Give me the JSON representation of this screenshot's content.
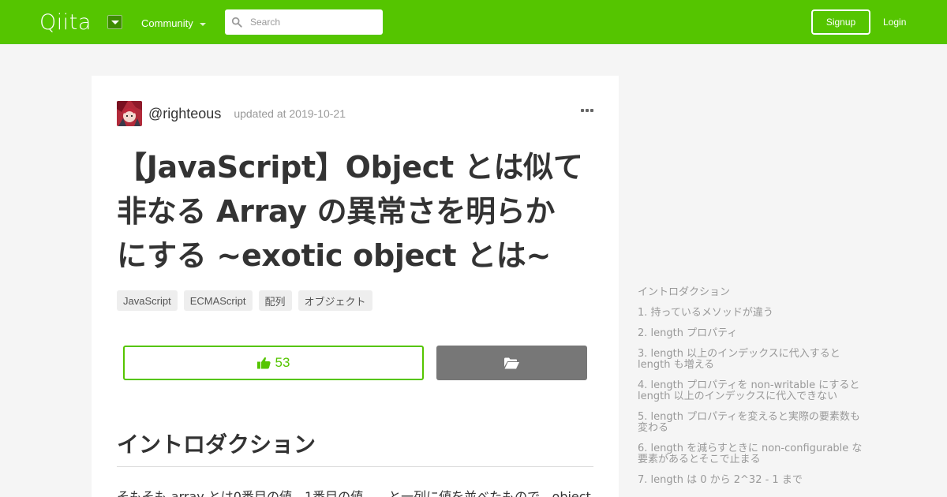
{
  "header": {
    "logo_text": "Qiita",
    "community_label": "Community",
    "search_placeholder": "Search",
    "signup_label": "Signup",
    "login_label": "Login",
    "brand_color": "#55c500"
  },
  "article": {
    "username": "@righteous",
    "updated": "updated at 2019-10-21",
    "title_lines": [
      "【JavaScript】Object とは似て",
      "非なる Array の異常さを明らか",
      "にする ~exotic object とは~"
    ],
    "tags": [
      "JavaScript",
      "ECMAScript",
      "配列",
      "オブジェクト"
    ],
    "likes": "53",
    "section_heading": "イントロダクション",
    "body_first_line": "そもそも array とは0番目の値、1番目の値、…と一列に値を並べたもので、object"
  },
  "toc": {
    "items": [
      "イントロダクション",
      "1. 持っているメソッドが違う",
      "2. length プロパティ",
      "3. length 以上のインデックスに代入すると length も増える",
      "4. length プロパティを non-writable にすると length 以上のインデックスに代入できない",
      "5. length プロパティを変えると実際の要素数も変わる",
      "6. length を減らすときに non-configurable な要素があるとそこで止まる",
      "7. length は 0 から 2^32 - 1 まで"
    ]
  }
}
